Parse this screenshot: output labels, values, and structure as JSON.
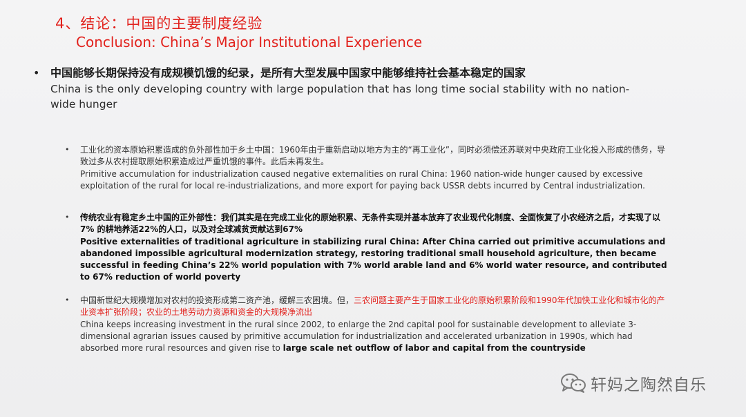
{
  "title": {
    "zh": "4、结论：中国的主要制度经验",
    "en": "Conclusion: China’s Major Institutional Experience"
  },
  "main_point": {
    "bullet": "•",
    "zh": "中国能够长期保持没有成规模饥饿的纪录，是所有大型发展中国家中能够维持社会基本稳定的国家",
    "en": "China is the only developing country with large population that has long time social stability with no nation-wide hunger"
  },
  "sub_points": [
    {
      "bullet": "•",
      "zh": "工业化的资本原始积累造成的负外部性加于乡土中国：1960年由于重新启动以地方为主的“再工业化”，同时必须偿还苏联对中央政府工业化投入形成的债务，导致过多从农村提取原始积累造成过严重饥饿的事件。此后未再发生。",
      "en": "Primitive accumulation for industrialization caused negative externalities on rural China: 1960 nation-wide hunger caused by excessive exploitation of the rural for local re-industrializations, and more export for paying back USSR debts incurred by Central industrialization."
    },
    {
      "bullet": "•",
      "zh": "传统农业有稳定乡土中国的正外部性：我们其实是在完成工业化的原始积累、无条件实现并基本放弃了农业现代化制度、全面恢复了小农经济之后，才实现了以7% 的耕地养活22%的人口，以及对全球减贫贡献达到67%",
      "en": "Positive externalities of traditional agriculture in stabilizing rural China: After China carried out primitive accumulations and abandoned impossible agricultural modernization strategy, restoring traditional small household agriculture, then became successful in feeding China’s 22% world population with 7% world arable land and 6% world water resource, and contributed to 67% reduction of world poverty"
    },
    {
      "bullet": "•",
      "zh_plain": "中国新世纪大规模增加对农村的投资形成第二资产池，缓解三农困境。但，",
      "zh_red": "三农问题主要产生于国家工业化的原始积累阶段和1990年代加快工业化和城市化的产业资本扩张阶段；农业的土地劳动力资源和资金的大规模净流出",
      "en_plain": "China keeps increasing investment in the rural since 2002, to enlarge the 2nd capital pool for sustainable development to alleviate 3-dimensional agrarian issues caused by primitive accumulation for industrialization and accelerated urbanization in 1990s, which had absorbed more rural resources and given rise to ",
      "en_bold": "large scale net outflow of labor and capital from the countryside"
    }
  ],
  "watermark": {
    "icon": "wechat-icon",
    "text": "轩妈之陶然自乐"
  },
  "colors": {
    "accent": "#e2221d",
    "background": "#f1f1f2",
    "text": "#2a2a2a"
  }
}
